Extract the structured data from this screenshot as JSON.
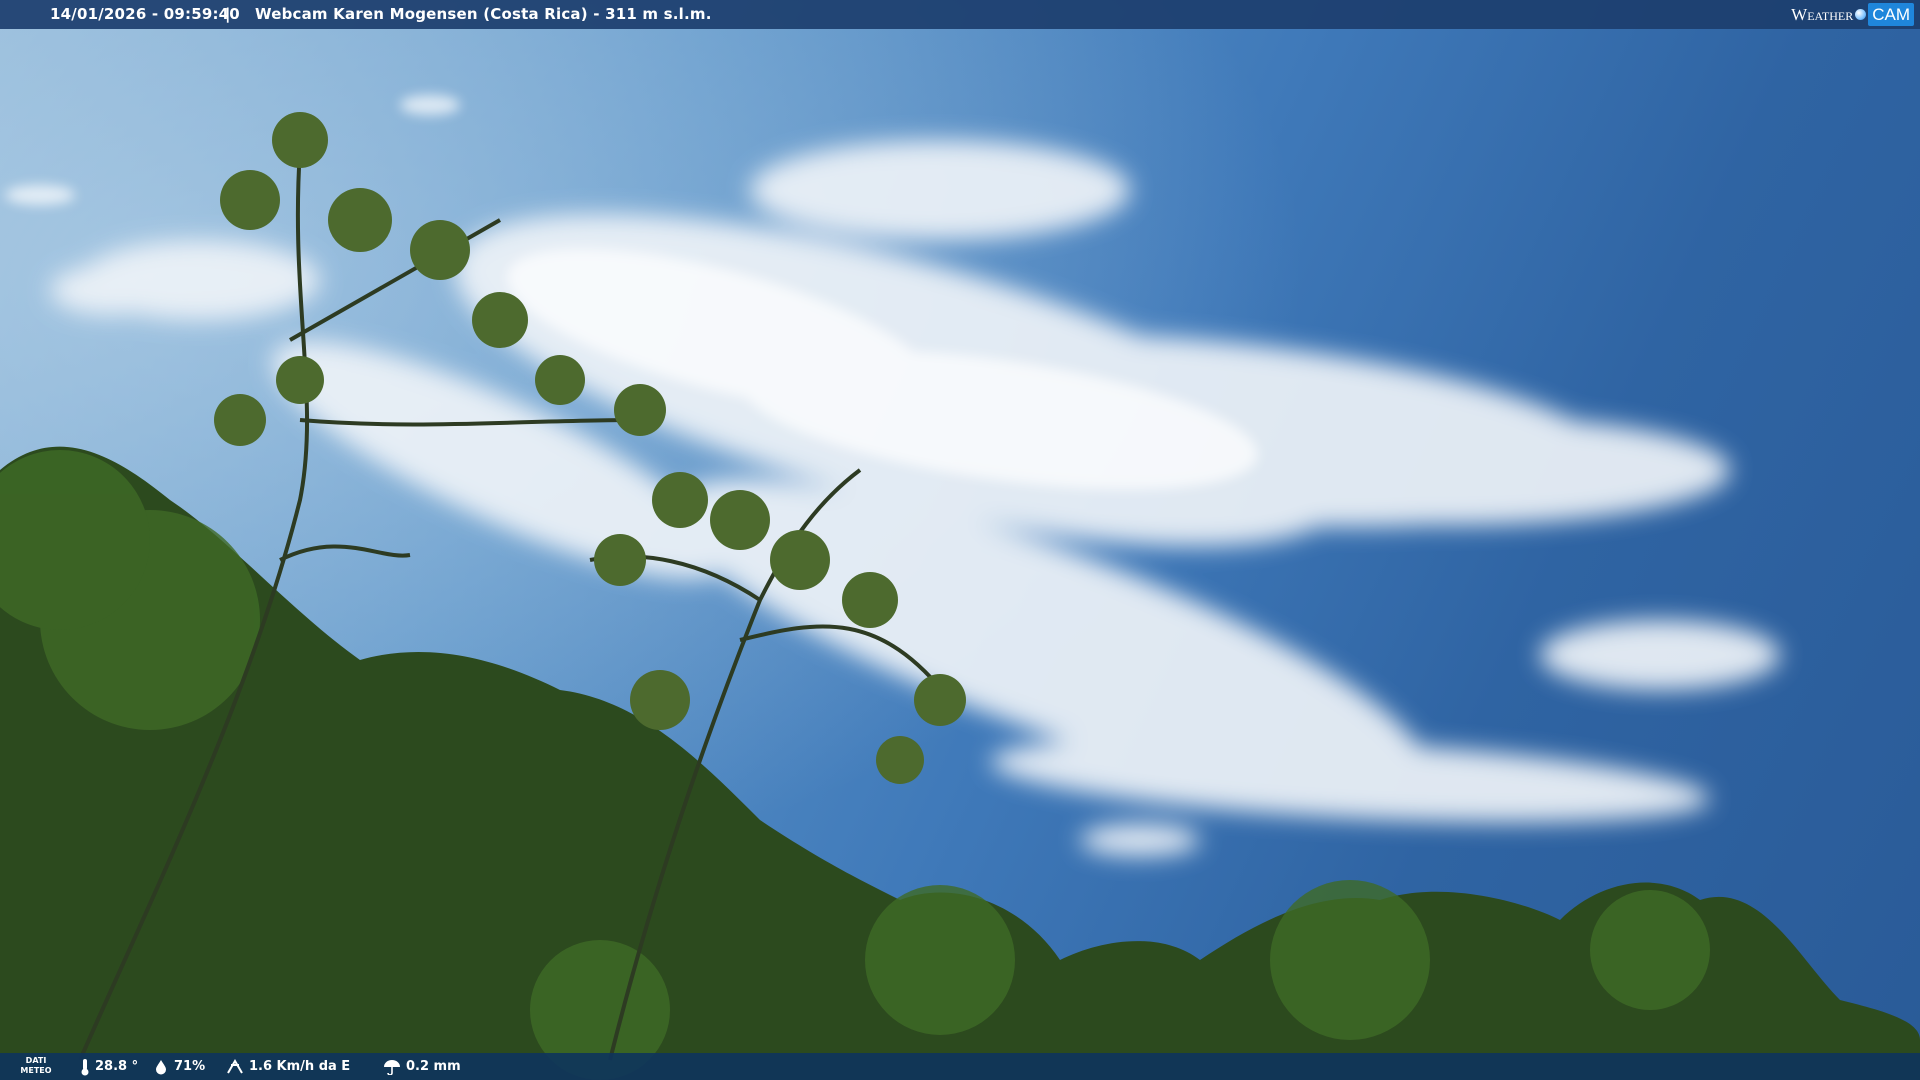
{
  "overlay": {
    "datetime": "14/01/2026 - 09:59:40",
    "separator": "|",
    "title": "Webcam Karen Mogensen (Costa Rica) - 311 m s.l.m.",
    "brand_weather": "Weather",
    "brand_cam": "CAM"
  },
  "meteo": {
    "label_line1": "DATI",
    "label_line2": "METEO",
    "temperature": "28.8 °",
    "humidity": "71%",
    "wind": "1.6 Km/h da E",
    "rain": "0.2 mm"
  },
  "icons": {
    "temperature": "thermometer-icon",
    "humidity": "humidity-drop-icon",
    "wind": "wind-icon",
    "rain": "rain-umbrella-icon"
  },
  "colors": {
    "overlay_bar": "#1c3e6e",
    "sky_light": "#8db6d8",
    "sky_dark": "#2a5b98",
    "foliage": "#2f4a22",
    "brand_accent": "#1f86db"
  }
}
